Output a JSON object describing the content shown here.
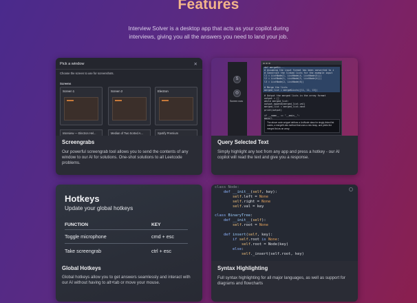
{
  "page": {
    "title": "Features",
    "subtitle": "Interview Solver is a desktop app that acts as your copilot during interviews, giving you all the answers you need to land your job."
  },
  "screengrabs": {
    "title": "Screengrabs",
    "description": "Our powerful screengrab tool allows you to send the contents of any window to our AI for solutions. One-shot solutions to all Leetcode problems.",
    "picker": {
      "window_title": "Pick a window",
      "close_glyph": "✕",
      "instruction": "Choose the screen to use for screenshots.",
      "screens_label": "Screens",
      "screens": [
        "Screen 1",
        "Screen 2",
        "Electron"
      ],
      "windows": [
        "Interview — Electron Hel...",
        "Median of Two Sorted A...",
        "Spotify Premium"
      ]
    }
  },
  "query_text": {
    "title": "Query Selected Text",
    "description": "Simply highlight any text from any app and press a hotkey - our AI copilot will read the text and give you a response.",
    "screen_now": "Screen now",
    "dock_icons": [
      "S",
      "◎"
    ],
    "code_lines": [
      "def mergeKLi...",
      "  # Assuming the input format has been converted to i",
      "  # Construct the linked lists for the example input",
      "  l1 = ListNode(1, ListNode(4, ListNode(5)))",
      "  l2 = ListNode(1, ListNode(3, ListNode(4)))",
      "  l3 = ListNode(2, ListNode(6))",
      "",
      "  # Merge the lists",
      "  merged_list = mergeKLists([l1, l2, l3])",
      "",
      "  # Output the merged lists in the array format",
      "  output = []",
      "  while merged_list:",
      "      output.append(merged_list.val)",
      "      merged_list = merged_list.next",
      "  print(output)",
      "",
      "if __name__ == \"__main__\":",
      "    main()"
    ],
    "popup_text": "The above code snippet defines a ListNode class for singly-linked list nodes, a mergeKLists method that uses a min-heap, and prints the merged list as an array."
  },
  "hotkeys": {
    "title": "Hotkeys",
    "subtitle": "Update your global hotkeys",
    "col_function": "FUNCTION",
    "col_key": "KEY",
    "rows": [
      {
        "function": "Toggle microphone",
        "key": "cmd + esc"
      },
      {
        "function": "Take screengrab",
        "key": "ctrl + esc"
      }
    ],
    "card_title": "Global Hotkeys",
    "description": "Global hotkeys allow you to get answers seamlessly and interact with our AI without having to alt+tab or move your mouse."
  },
  "syntax": {
    "title": "Syntax Highlighting",
    "description": "Full syntax highlighting for all major languages, as well as support for diagrams and flowcharts",
    "code": [
      [
        {
          "t": "class ",
          "c": "dim"
        },
        {
          "t": "Node",
          "c": "dim"
        },
        {
          "t": ":",
          "c": "dim"
        }
      ],
      [
        {
          "t": "    "
        },
        {
          "t": "def ",
          "c": "kw"
        },
        {
          "t": "__init__",
          "c": "fn"
        },
        {
          "t": "("
        },
        {
          "t": "self",
          "c": "sf"
        },
        {
          "t": ", key):"
        }
      ],
      [
        {
          "t": "        "
        },
        {
          "t": "self",
          "c": "sf"
        },
        {
          "t": ".left = "
        },
        {
          "t": "None",
          "c": "nm"
        }
      ],
      [
        {
          "t": "        "
        },
        {
          "t": "self",
          "c": "sf"
        },
        {
          "t": ".right = "
        },
        {
          "t": "None",
          "c": "nm"
        }
      ],
      [
        {
          "t": "        "
        },
        {
          "t": "self",
          "c": "sf"
        },
        {
          "t": ".val = key"
        }
      ],
      [
        {
          "t": ""
        }
      ],
      [
        {
          "t": "class ",
          "c": "kw"
        },
        {
          "t": "BinaryTree",
          "c": "fn"
        },
        {
          "t": ":"
        }
      ],
      [
        {
          "t": "    "
        },
        {
          "t": "def ",
          "c": "kw"
        },
        {
          "t": "__init__",
          "c": "fn"
        },
        {
          "t": "("
        },
        {
          "t": "self",
          "c": "sf"
        },
        {
          "t": "):"
        }
      ],
      [
        {
          "t": "        "
        },
        {
          "t": "self",
          "c": "sf"
        },
        {
          "t": ".root = "
        },
        {
          "t": "None",
          "c": "nm"
        }
      ],
      [
        {
          "t": ""
        }
      ],
      [
        {
          "t": "    "
        },
        {
          "t": "def ",
          "c": "kw"
        },
        {
          "t": "insert",
          "c": "fn"
        },
        {
          "t": "("
        },
        {
          "t": "self",
          "c": "sf"
        },
        {
          "t": ", key):"
        }
      ],
      [
        {
          "t": "        "
        },
        {
          "t": "if ",
          "c": "kw"
        },
        {
          "t": "self",
          "c": "sf"
        },
        {
          "t": ".root "
        },
        {
          "t": "is ",
          "c": "kw"
        },
        {
          "t": "None",
          "c": "nm"
        },
        {
          "t": ":"
        }
      ],
      [
        {
          "t": "            "
        },
        {
          "t": "self",
          "c": "sf"
        },
        {
          "t": ".root = Node(key)"
        }
      ],
      [
        {
          "t": "        "
        },
        {
          "t": "else",
          "c": "kw"
        },
        {
          "t": ":"
        }
      ],
      [
        {
          "t": "            "
        },
        {
          "t": "self",
          "c": "sf"
        },
        {
          "t": "._insert(self.root, key)"
        }
      ]
    ]
  }
}
